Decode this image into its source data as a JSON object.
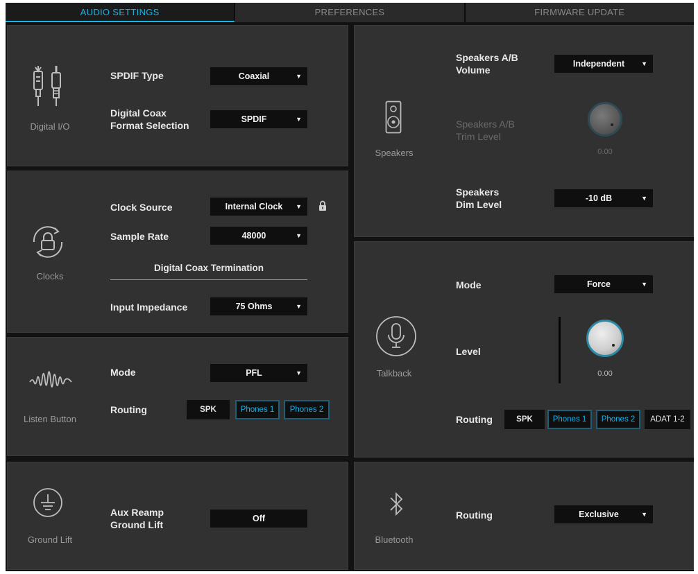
{
  "tabs": [
    "AUDIO SETTINGS",
    "PREFERENCES",
    "FIRMWARE UPDATE"
  ],
  "digital_io": {
    "title": "Digital I/O",
    "spdif_type_label": "SPDIF Type",
    "spdif_type_value": "Coaxial",
    "coax_format_label_1": "Digital Coax",
    "coax_format_label_2": "Format Selection",
    "coax_format_value": "SPDIF"
  },
  "clocks": {
    "title": "Clocks",
    "clock_source_label": "Clock Source",
    "clock_source_value": "Internal Clock",
    "sample_rate_label": "Sample Rate",
    "sample_rate_value": "48000",
    "termination_heading": "Digital Coax Termination",
    "input_impedance_label": "Input Impedance",
    "input_impedance_value": "75 Ohms"
  },
  "listen": {
    "title": "Listen Button",
    "mode_label": "Mode",
    "mode_value": "PFL",
    "routing_label": "Routing",
    "routing": [
      {
        "label": "SPK",
        "active": false
      },
      {
        "label": "Phones 1",
        "active": true
      },
      {
        "label": "Phones 2",
        "active": true
      }
    ]
  },
  "ground": {
    "title": "Ground Lift",
    "aux_label_1": "Aux Reamp",
    "aux_label_2": "Ground Lift",
    "aux_value": "Off"
  },
  "speakers": {
    "title": "Speakers",
    "ab_volume_label_1": "Speakers A/B",
    "ab_volume_label_2": "Volume",
    "ab_volume_value": "Independent",
    "trim_label_1": "Speakers A/B",
    "trim_label_2": "Trim Level",
    "trim_value": "0.00",
    "dim_label_1": "Speakers",
    "dim_label_2": "Dim Level",
    "dim_value": "-10 dB"
  },
  "talkback": {
    "title": "Talkback",
    "mode_label": "Mode",
    "mode_value": "Force",
    "level_label": "Level",
    "level_value": "0.00",
    "routing_label": "Routing",
    "routing": [
      {
        "label": "SPK",
        "active": false
      },
      {
        "label": "Phones 1",
        "active": true
      },
      {
        "label": "Phones 2",
        "active": true
      },
      {
        "label": "ADAT 1-2",
        "active": false
      }
    ]
  },
  "bluetooth": {
    "title": "Bluetooth",
    "routing_label": "Routing",
    "routing_value": "Exclusive"
  },
  "icons": {
    "dropdown_arrow": "▼",
    "lock": "lock-icon"
  },
  "colors": {
    "accent": "#19b3e6",
    "panel": "#313131",
    "control": "#0f0f0f"
  }
}
